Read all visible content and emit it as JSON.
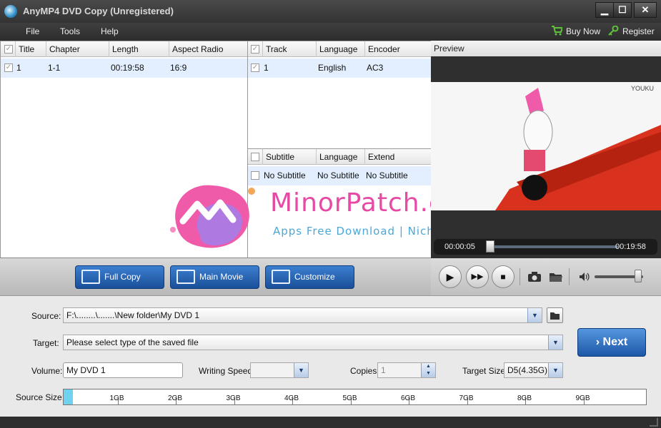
{
  "window": {
    "title": "AnyMP4 DVD Copy (Unregistered)",
    "min": "▁",
    "max": "☐",
    "close": "✕"
  },
  "menu": {
    "file": "File",
    "tools": "Tools",
    "help": "Help",
    "buy": "Buy Now",
    "register": "Register"
  },
  "titles": {
    "headers": [
      "Title",
      "Chapter",
      "Length",
      "Aspect Radio"
    ],
    "rows": [
      {
        "title": "1",
        "chapter": "1-1",
        "length": "00:19:58",
        "aspect": "16:9"
      }
    ]
  },
  "tracks": {
    "headers": [
      "Track",
      "Language",
      "Encoder"
    ],
    "rows": [
      {
        "track": "1",
        "language": "English",
        "encoder": "AC3"
      }
    ]
  },
  "subtitles": {
    "headers": [
      "Subtitle",
      "Language",
      "Extend"
    ],
    "rows": [
      {
        "subtitle": "No Subtitle",
        "language": "No Subtitle",
        "extend": "No Subtitle"
      }
    ]
  },
  "modes": {
    "full_copy": "Full Copy",
    "main_movie": "Main Movie",
    "customize": "Customize"
  },
  "preview": {
    "label": "Preview",
    "current_time": "00:00:05",
    "total_time": "00:19:58",
    "progress": 0.004,
    "volume": 0.9,
    "video_mark": "YOUKU"
  },
  "watermark": {
    "main": "MinorPatch.com",
    "sub": "Apps Free Download | Niche Solution"
  },
  "settings": {
    "source_label": "Source:",
    "source_value": "F:\\........\\.......\\New folder\\My DVD 1",
    "target_label": "Target:",
    "target_value": "Please select type of the saved file",
    "volume_label": "Volume:",
    "volume_value": "My DVD 1",
    "speed_label": "Writing Speed:",
    "speed_value": "",
    "copies_label": "Copies:",
    "copies_value": "1",
    "target_size_label": "Target Size:",
    "target_size_value": "D5(4.35G)",
    "source_size_label": "Source Size:",
    "size_ticks": [
      "1GB",
      "2GB",
      "3GB",
      "4GB",
      "5GB",
      "6GB",
      "7GB",
      "8GB",
      "9GB"
    ],
    "source_size_fraction": 0.016,
    "next": "Next"
  },
  "colors": {
    "accent_blue": "#1d57a6",
    "selected_row": "#e3efff",
    "size_fill": "#6fd3ef",
    "watermark": "#e64aa5"
  }
}
